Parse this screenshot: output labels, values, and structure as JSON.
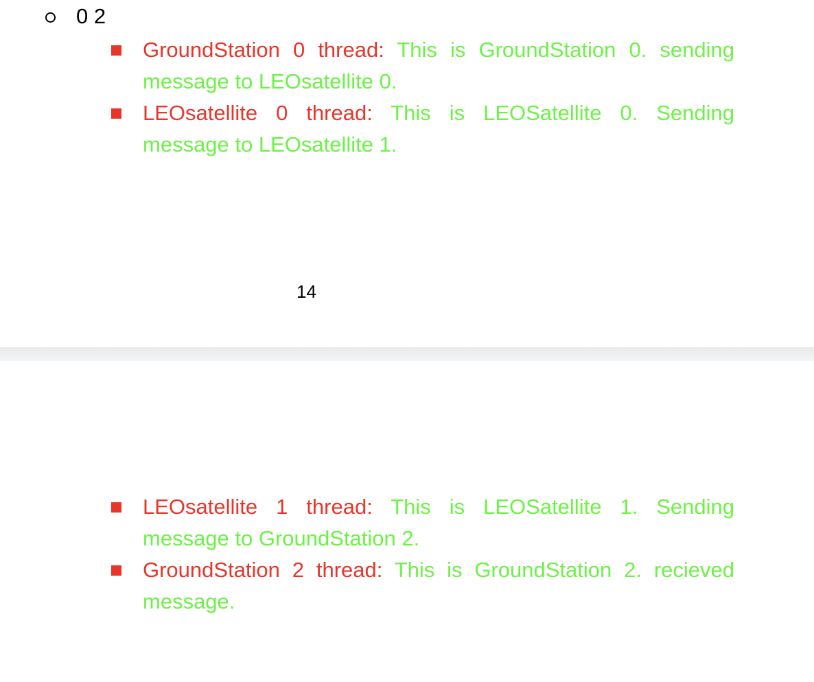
{
  "page1": {
    "sub_item_label": "0 2",
    "entries": [
      {
        "label": "GroundStation 0 thread:",
        "message": "This is GroundStation 0. sending message to LEOsatellite 0."
      },
      {
        "label": "LEOsatellite 0 thread:",
        "message": "This is LEOSatellite 0. Sending message to LEOsatellite 1."
      }
    ],
    "page_number": "14"
  },
  "page2": {
    "entries": [
      {
        "label": "LEOsatellite 1 thread:",
        "message": "This is LEOSatellite 1. Sending message to GroundStation 2."
      },
      {
        "label": "GroundStation 2 thread:",
        "message": "This is GroundStation 2. recieved message."
      }
    ]
  },
  "colors": {
    "label": "#e8352a",
    "message": "#6cf245"
  }
}
